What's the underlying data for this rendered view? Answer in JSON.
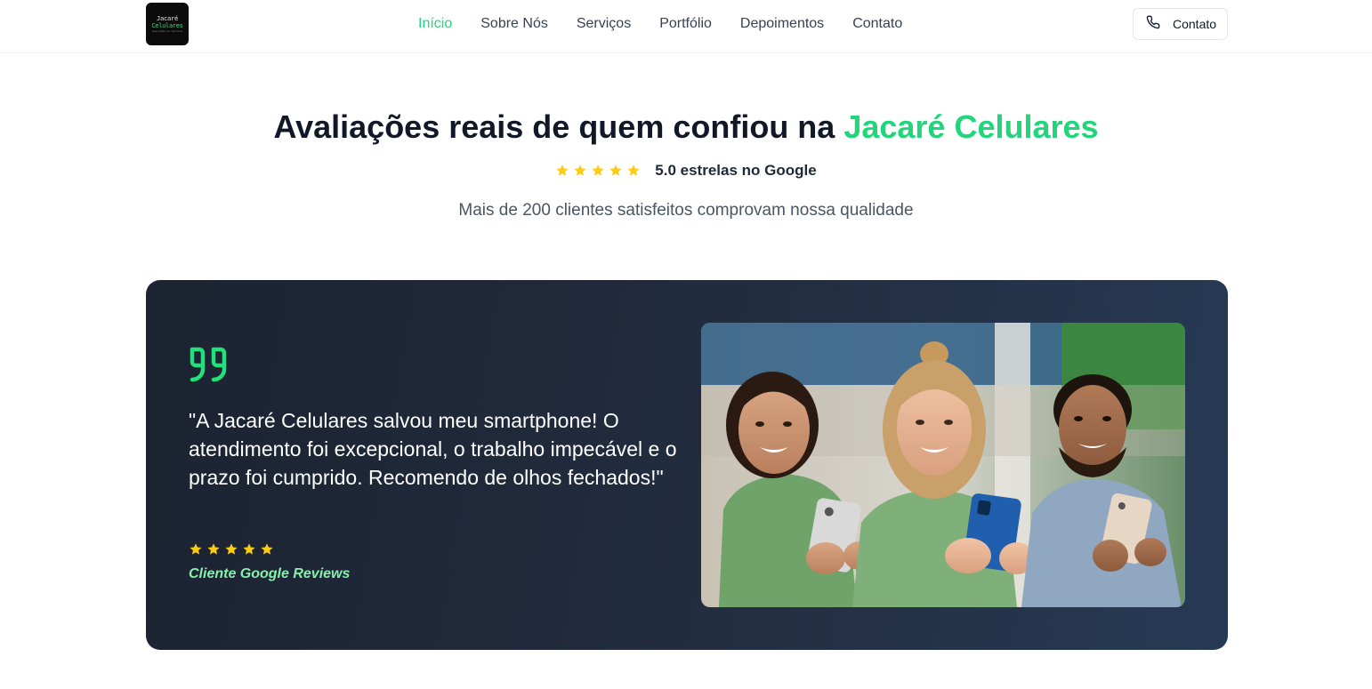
{
  "header": {
    "logo": {
      "line1": "Jacaré",
      "line2": "Celulares",
      "line3": "assistência técnica"
    },
    "nav": [
      {
        "label": "Início",
        "active": true
      },
      {
        "label": "Sobre Nós",
        "active": false
      },
      {
        "label": "Serviços",
        "active": false
      },
      {
        "label": "Portfólio",
        "active": false
      },
      {
        "label": "Depoimentos",
        "active": false
      },
      {
        "label": "Contato",
        "active": false
      }
    ],
    "contact_button": {
      "label": "Contato",
      "icon": "phone-icon"
    }
  },
  "hero": {
    "title_prefix": "Avaliações reais de quem confiou na ",
    "title_accent": "Jacaré Celulares",
    "rating": {
      "stars": 5,
      "text": "5.0 estrelas no Google"
    },
    "subtitle": "Mais de 200 clientes satisfeitos comprovam nossa qualidade"
  },
  "testimonial": {
    "quote_icon": "quote-icon",
    "text": "\"A Jacaré Celulares salvou meu smartphone! O atendimento foi excepcional, o trabalho impecável e o prazo foi cumprido. Recomendo de olhos fechados!\"",
    "stars": 5,
    "reviewer": "Cliente Google Reviews",
    "image": "photo of three smiling people holding smartphones"
  },
  "colors": {
    "accent": "#22d47a",
    "star": "#facc15",
    "card_bg_start": "#1c2331",
    "card_bg_end": "#273a55",
    "reviewer": "#86efac"
  }
}
